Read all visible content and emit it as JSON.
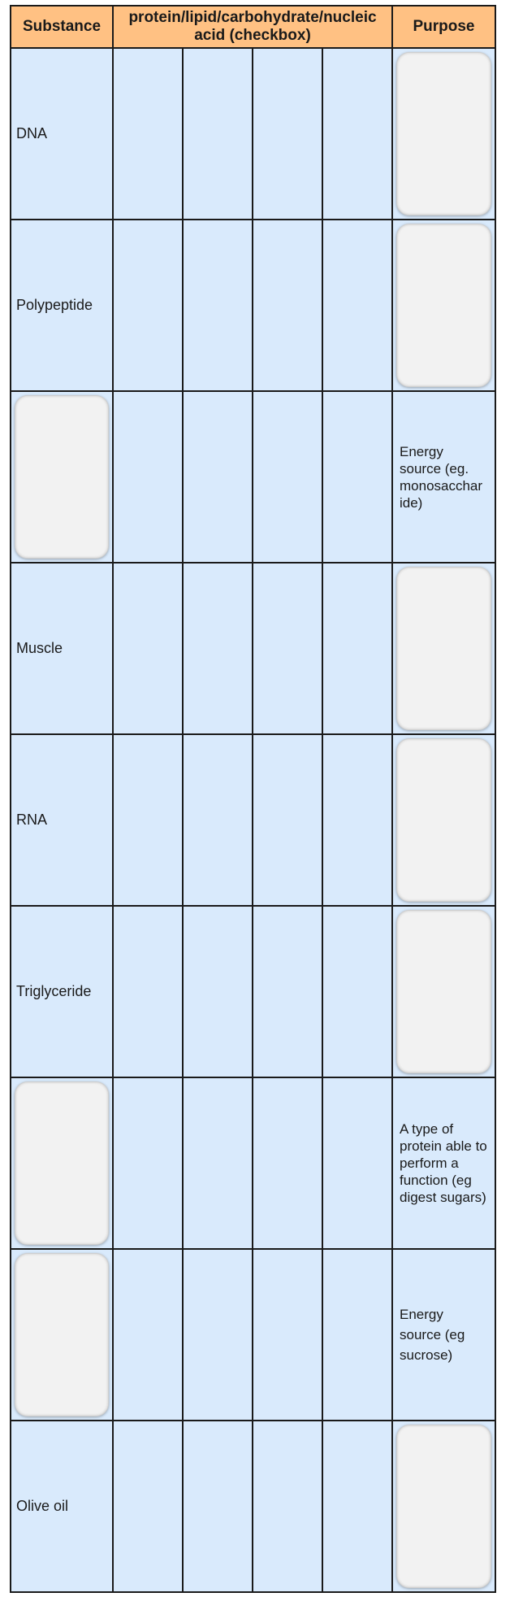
{
  "header": {
    "substance": "Substance",
    "classification": "protein/lipid/carbohydrate/nucleic acid (checkbox)",
    "purpose": "Purpose"
  },
  "rows": [
    {
      "substance": "DNA",
      "purpose": ""
    },
    {
      "substance": "Polypeptide",
      "purpose": ""
    },
    {
      "substance": "",
      "purpose": "Energy source (eg. monosacchar ide)"
    },
    {
      "substance": "Muscle",
      "purpose": ""
    },
    {
      "substance": "RNA",
      "purpose": ""
    },
    {
      "substance": "Triglyceride",
      "purpose": ""
    },
    {
      "substance": "",
      "purpose": "A type of protein able to perform a function (eg digest sugars)"
    },
    {
      "substance": "",
      "purpose": "Energy source (eg sucrose)"
    },
    {
      "substance": "Olive oil",
      "purpose": ""
    }
  ],
  "colors": {
    "header_bg": "#ffc183",
    "cell_bg": "#d9eafc",
    "drop_box_bg": "#f2f2f2",
    "border": "#1a1a1a"
  }
}
